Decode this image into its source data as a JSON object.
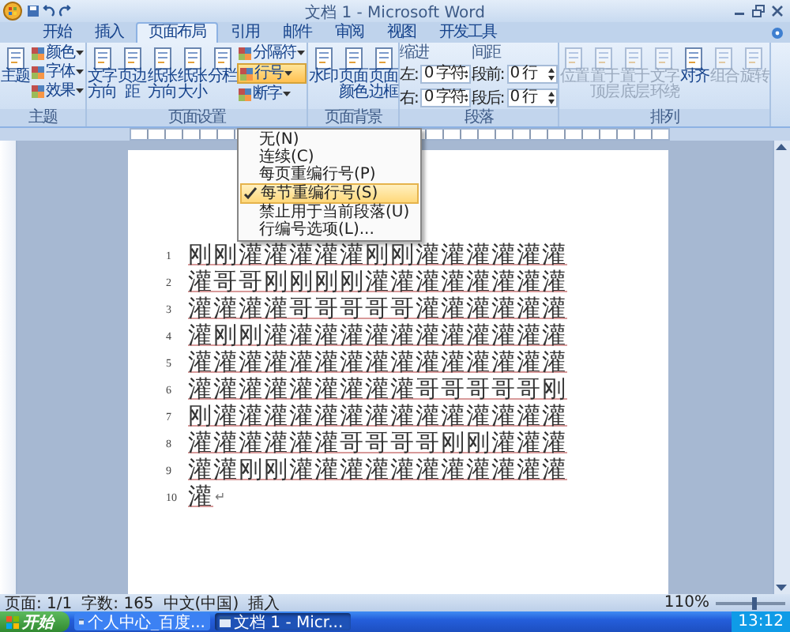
{
  "window": {
    "title": "文档 1 - Microsoft Word"
  },
  "tabs": [
    {
      "label": "开始",
      "selected": false
    },
    {
      "label": "插入",
      "selected": false
    },
    {
      "label": "页面布局",
      "selected": true
    },
    {
      "label": "引用",
      "selected": false
    },
    {
      "label": "邮件",
      "selected": false
    },
    {
      "label": "审阅",
      "selected": false
    },
    {
      "label": "视图",
      "selected": false
    },
    {
      "label": "开发工具",
      "selected": false
    }
  ],
  "ribbon": [
    {
      "label": "主题",
      "columns": [
        [
          {
            "kind": "large",
            "label": "主题",
            "disabled": false
          }
        ],
        [
          {
            "kind": "small",
            "label": "颜色",
            "expanded": false
          },
          {
            "kind": "small",
            "label": "字体",
            "expanded": false
          },
          {
            "kind": "small",
            "label": "效果",
            "expanded": false
          }
        ]
      ]
    },
    {
      "label": "页面设置",
      "columns": [
        [
          {
            "kind": "large",
            "label": "文字方向",
            "disabled": false
          }
        ],
        [
          {
            "kind": "large",
            "label": "页边距",
            "disabled": false
          }
        ],
        [
          {
            "kind": "large",
            "label": "纸张方向",
            "disabled": false
          }
        ],
        [
          {
            "kind": "large",
            "label": "纸张大小",
            "disabled": false
          }
        ],
        [
          {
            "kind": "large",
            "label": "分栏",
            "disabled": false
          }
        ],
        [
          {
            "kind": "small",
            "label": "分隔符",
            "expanded": false
          },
          {
            "kind": "small",
            "label": "行号",
            "expanded": true,
            "menu": [
              {
                "label": "无(N)",
                "checked": false
              },
              {
                "label": "连续(C)",
                "checked": false
              },
              {
                "label": "每页重编行号(P)",
                "checked": false
              },
              {
                "label": "每节重编行号(S)",
                "checked": true
              },
              {
                "label": "禁止用于当前段落(U)",
                "checked": false
              },
              {
                "label": "行编号选项(L)...",
                "checked": false
              }
            ]
          },
          {
            "kind": "small",
            "label": "断字",
            "expanded": false
          }
        ]
      ]
    },
    {
      "label": "页面背景",
      "columns": [
        [
          {
            "kind": "large",
            "label": "水印",
            "disabled": false
          }
        ],
        [
          {
            "kind": "large",
            "label": "页面颜色",
            "disabled": false
          }
        ],
        [
          {
            "kind": "large",
            "label": "页面边框",
            "disabled": false
          }
        ]
      ]
    },
    {
      "label": "段落",
      "columns": [
        [
          {
            "kind": "heading",
            "label": "缩进"
          },
          {
            "kind": "field",
            "label": "左:",
            "value": "0 字符"
          },
          {
            "kind": "field",
            "label": "右:",
            "value": "0 字符"
          }
        ],
        [
          {
            "kind": "heading",
            "label": "间距"
          },
          {
            "kind": "field",
            "label": "段前:",
            "value": "0 行"
          },
          {
            "kind": "field",
            "label": "段后:",
            "value": "0 行"
          }
        ]
      ]
    },
    {
      "label": "排列",
      "columns": [
        [
          {
            "kind": "large",
            "label": "位置",
            "disabled": true
          }
        ],
        [
          {
            "kind": "large",
            "label": "置于顶层",
            "disabled": true
          }
        ],
        [
          {
            "kind": "large",
            "label": "置于底层",
            "disabled": true
          }
        ],
        [
          {
            "kind": "large",
            "label": "文字环绕",
            "disabled": true
          }
        ],
        [
          {
            "kind": "large",
            "label": "对齐",
            "disabled": false
          }
        ],
        [
          {
            "kind": "large",
            "label": "组合",
            "disabled": true
          }
        ],
        [
          {
            "kind": "large",
            "label": "旋转",
            "disabled": true
          }
        ]
      ]
    }
  ],
  "document": {
    "lines": [
      {
        "number": "1",
        "text": "刚刚灌灌灌灌灌刚刚灌灌灌灌灌灌"
      },
      {
        "number": "2",
        "text": "灌哥哥刚刚刚刚灌灌灌灌灌灌灌灌"
      },
      {
        "number": "3",
        "text": "灌灌灌灌哥哥哥哥哥灌灌灌灌灌灌"
      },
      {
        "number": "4",
        "text": "灌刚刚灌灌灌灌灌灌灌灌灌灌灌灌"
      },
      {
        "number": "5",
        "text": "灌灌灌灌灌灌灌灌灌灌灌灌灌灌灌"
      },
      {
        "number": "6",
        "text": "灌灌灌灌灌灌灌灌灌哥哥哥哥哥刚"
      },
      {
        "number": "7",
        "text": "刚灌灌灌灌灌灌灌灌灌灌灌灌灌灌"
      },
      {
        "number": "8",
        "text": "灌灌灌灌灌灌哥哥哥哥刚刚灌灌灌"
      },
      {
        "number": "9",
        "text": "灌灌刚刚灌灌灌灌灌灌灌灌灌灌灌"
      },
      {
        "number": "10",
        "text": "灌",
        "mark": "↵"
      }
    ]
  },
  "status_bar": {
    "items": [
      "页面: 1/1",
      "字数: 165",
      "中文(中国)",
      "插入"
    ],
    "zoom": "110%",
    "zoom_slider": {
      "level": 0.52
    }
  },
  "taskbar": {
    "start": "开始",
    "tasks": [
      {
        "label": "个人中心_百度...",
        "selected": false
      },
      {
        "label": "文档 1 - Micr...",
        "selected": true
      }
    ],
    "clock": "13:12"
  }
}
